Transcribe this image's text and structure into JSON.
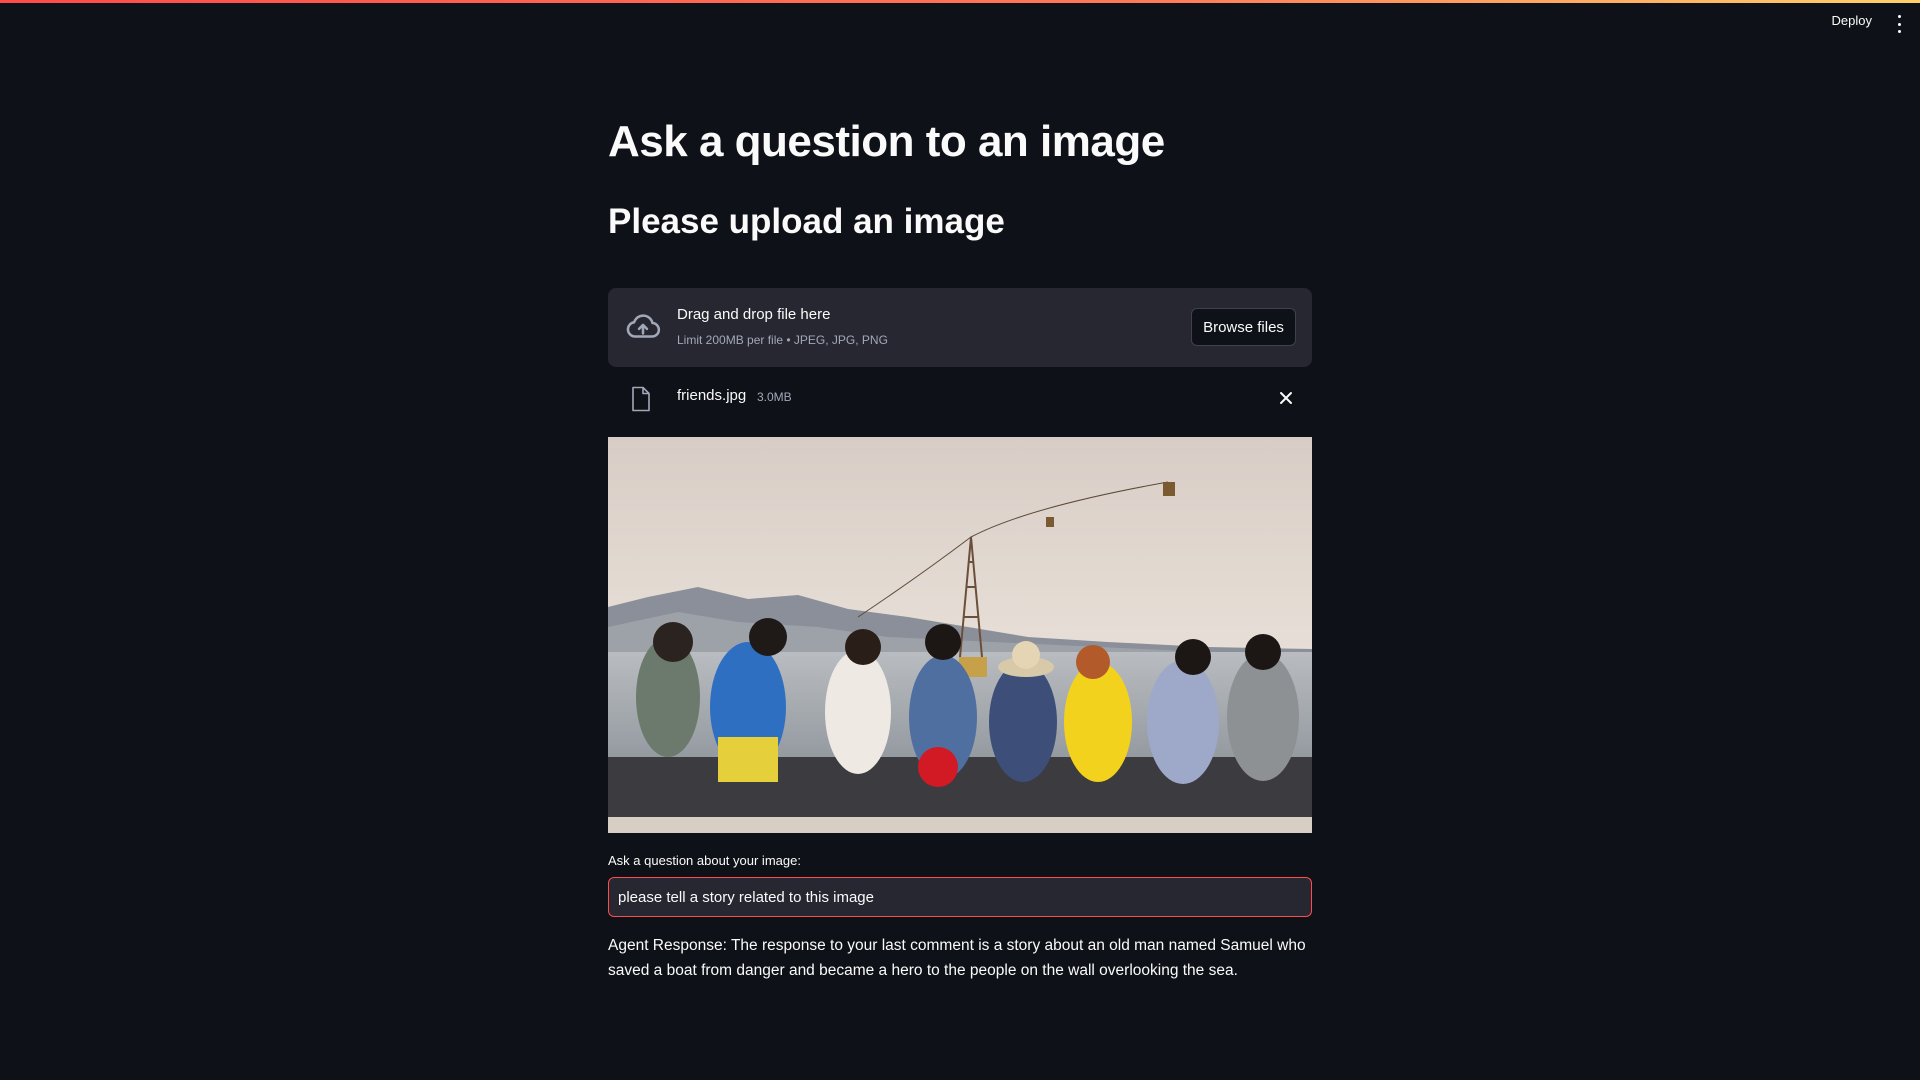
{
  "header": {
    "deploy_label": "Deploy",
    "menu_icon": "vertical-ellipsis-icon"
  },
  "main": {
    "title": "Ask a question to an image",
    "subtitle": "Please upload an image"
  },
  "uploader": {
    "icon": "cloud-upload-icon",
    "drop_title": "Drag and drop file here",
    "drop_limit": "Limit 200MB per file • JPEG, JPG, PNG",
    "browse_label": "Browse files"
  },
  "uploaded_file": {
    "icon": "file-icon",
    "name": "friends.jpg",
    "size": "3.0MB",
    "remove_icon": "close-icon"
  },
  "question": {
    "label": "Ask a question about your image:",
    "value": "please tell a story related to this image"
  },
  "response": {
    "text": "Agent Response: The response to your last comment is a story about an old man named Samuel who saved a boat from danger and became a hero to the people on the wall overlooking the sea."
  },
  "colors": {
    "background": "#0e1117",
    "surface": "#262730",
    "accent": "#ff4b4b",
    "text": "#fafafa",
    "muted": "#a3a8b8"
  }
}
